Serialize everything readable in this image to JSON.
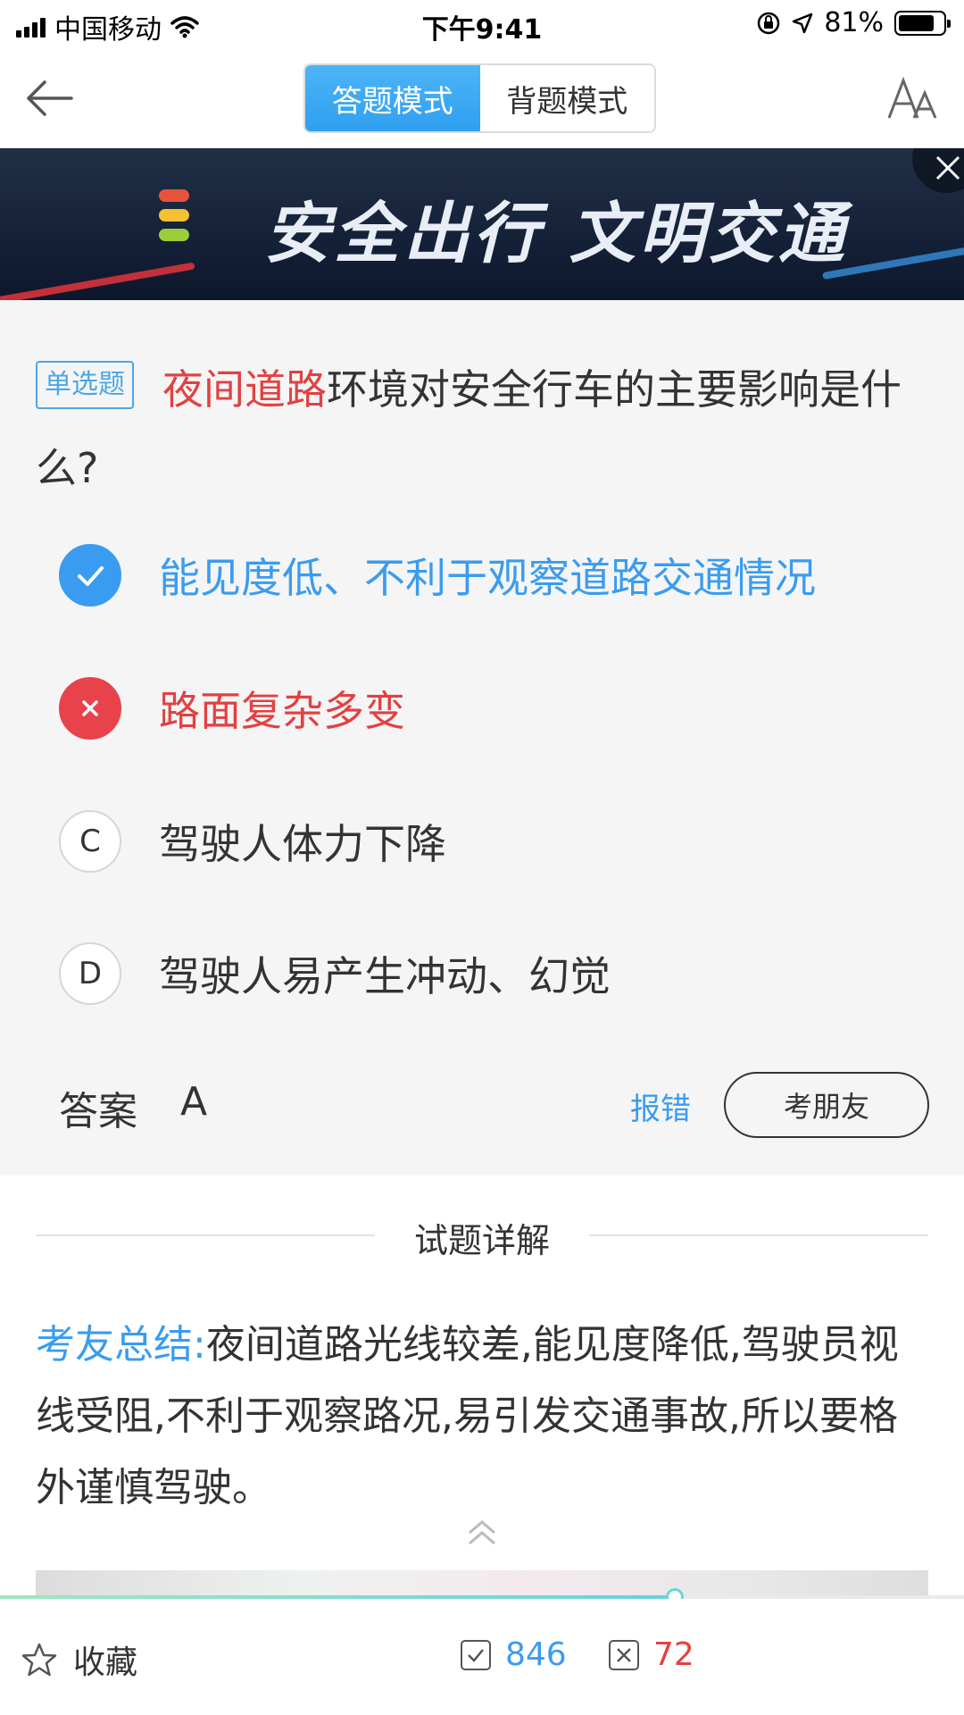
{
  "status_bar": {
    "carrier": "中国移动",
    "time": "下午9:41",
    "battery_text": "81%",
    "battery_level": 0.81
  },
  "nav": {
    "tabs": [
      {
        "label": "答题模式",
        "active": true
      },
      {
        "label": "背题模式",
        "active": false
      }
    ]
  },
  "banner": {
    "text": "安全出行 文明交通"
  },
  "question": {
    "type_tag": "单选题",
    "highlight": "夜间道路",
    "rest": "环境对安全行车的主要影响是什么?"
  },
  "options": [
    {
      "marker": "A",
      "text": "能见度低、不利于观察道路交通情况",
      "state": "correct"
    },
    {
      "marker": "B",
      "text": "路面复杂多变",
      "state": "wrong"
    },
    {
      "marker": "C",
      "text": "驾驶人体力下降",
      "state": "normal"
    },
    {
      "marker": "D",
      "text": "驾驶人易产生冲动、幻觉",
      "state": "normal"
    }
  ],
  "answer": {
    "label": "答案",
    "value": "A",
    "report_label": "报错",
    "ask_friend_label": "考朋友"
  },
  "explanation": {
    "title": "试题详解",
    "key_label": "考友总结:",
    "text": "夜间道路光线较差,能见度降低,驾驶员视线受阻,不利于观察路况,易引发交通事故,所以要格外谨慎驾驶。"
  },
  "progress": {
    "fraction": 0.7
  },
  "bottom_bar": {
    "favorite_label": "收藏",
    "correct_count": "846",
    "wrong_count": "72"
  },
  "colors": {
    "accent_blue": "#3a9cf0",
    "error_red": "#e24141"
  },
  "icons": [
    "back-arrow-icon",
    "font-size-icon",
    "close-icon",
    "check-icon",
    "cross-icon",
    "star-icon",
    "checkbox-icon",
    "double-chevron-up-icon",
    "wifi-icon",
    "location-arrow-icon",
    "orientation-lock-icon"
  ]
}
